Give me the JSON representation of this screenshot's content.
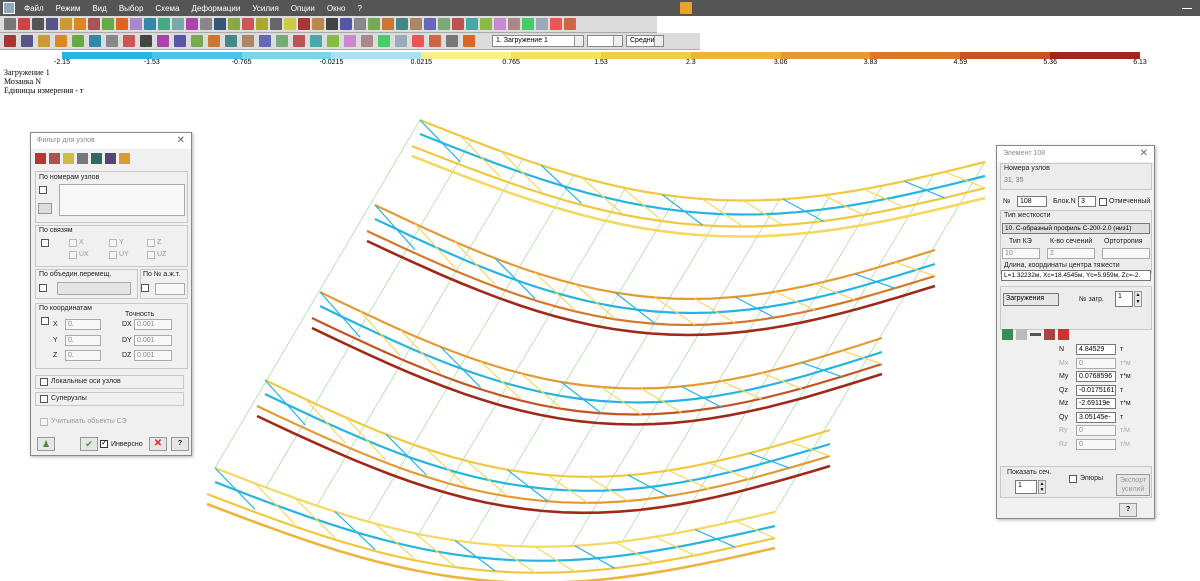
{
  "menu": [
    "Файл",
    "Режим",
    "Вид",
    "Выбор",
    "Схема",
    "Деформации",
    "Усилия",
    "Опции",
    "Окно",
    "?"
  ],
  "toolbar": {
    "load_case": "1. Загружение 1",
    "mid": "",
    "mode": "Средни"
  },
  "scale": {
    "ticks": [
      "-2.15",
      "-1.53",
      "-0.765",
      "-0.0215",
      "0.0215",
      "0.765",
      "1.53",
      "2.3",
      "3.06",
      "3.83",
      "4.59",
      "5.36",
      "6.13"
    ],
    "colors": [
      "#26b4e0",
      "#4cc3e6",
      "#7cd3ec",
      "#a6e2f0",
      "#f6ef8e",
      "#f4e060",
      "#f0cc48",
      "#ecb43c",
      "#e49a34",
      "#d8782c",
      "#c45424",
      "#a02818"
    ]
  },
  "info": {
    "line1": "Загружение 1",
    "line2": "Мозаика N",
    "line3": "Единицы измерения - т"
  },
  "node_filter": {
    "title": "Фильтр для узлов",
    "by_numbers": "По номерам узлов",
    "by_links": "По связям",
    "links": [
      "X",
      "Y",
      "Z",
      "UX",
      "UY",
      "UZ"
    ],
    "by_unified": "По объедин.перемещ.",
    "by_num_akt": "По № а.ж.т.",
    "by_coords": "По координатам",
    "precision": "Точность",
    "x": "X",
    "y": "Y",
    "z": "Z",
    "x_val": "0.",
    "y_val": "0.",
    "z_val": "0.",
    "dx": "DX",
    "dy": "DY",
    "dz": "DZ",
    "dx_val": "0.001",
    "dy_val": "0.001",
    "dz_val": "0.001",
    "local_axes": "Локальные оси узлов",
    "supernodes": "Суперузлы",
    "consider_fe": "Учитывать объекты СЭ",
    "inverse": "Инверсно"
  },
  "element": {
    "title": "Элемент 108",
    "nodes_label": "Номера узлов",
    "nodes_value": "31, 35",
    "num_label": "№",
    "num_value": "108",
    "block_label": "Блок.N",
    "block_value": "3",
    "marked": "Отмеченный",
    "stiff_label": "Тип жесткости",
    "stiff_value": "10. С-образный профиль С-200-2.0 (низ1)",
    "fe_type_label": "Тип КЭ",
    "fe_type_value": "10",
    "sections_label": "К-во сечений",
    "sections_value": "2",
    "ortho_label": "Ортотропия",
    "length_label": "Длина, координаты центра тяжести",
    "length_value": "L=1.32232м, Xc=18.4545м, Yc=5.959м, Zc=-2.",
    "loads_select": "Загружения",
    "load_no_label": "№ загр.",
    "load_no_value": "1",
    "forces": [
      {
        "name": "N",
        "value": "4.84529",
        "unit": "т",
        "active": true
      },
      {
        "name": "Mx",
        "value": "0",
        "unit": "т*м",
        "active": false
      },
      {
        "name": "My",
        "value": "0.0768596",
        "unit": "т*м",
        "active": true
      },
      {
        "name": "Qz",
        "value": "-0.0175161",
        "unit": "т",
        "active": true
      },
      {
        "name": "Mz",
        "value": "-2.69119e",
        "unit": "т*м",
        "active": true
      },
      {
        "name": "Qy",
        "value": "3.05145e-",
        "unit": "т",
        "active": true
      },
      {
        "name": "Ry",
        "value": "0",
        "unit": "т/м",
        "active": false
      },
      {
        "name": "Rz",
        "value": "0",
        "unit": "т/м",
        "active": false
      }
    ],
    "show_section_label": "Показать сеч.",
    "show_section_value": "1",
    "diagrams": "Эпюры",
    "export_btn": "Экспорт усилий"
  }
}
